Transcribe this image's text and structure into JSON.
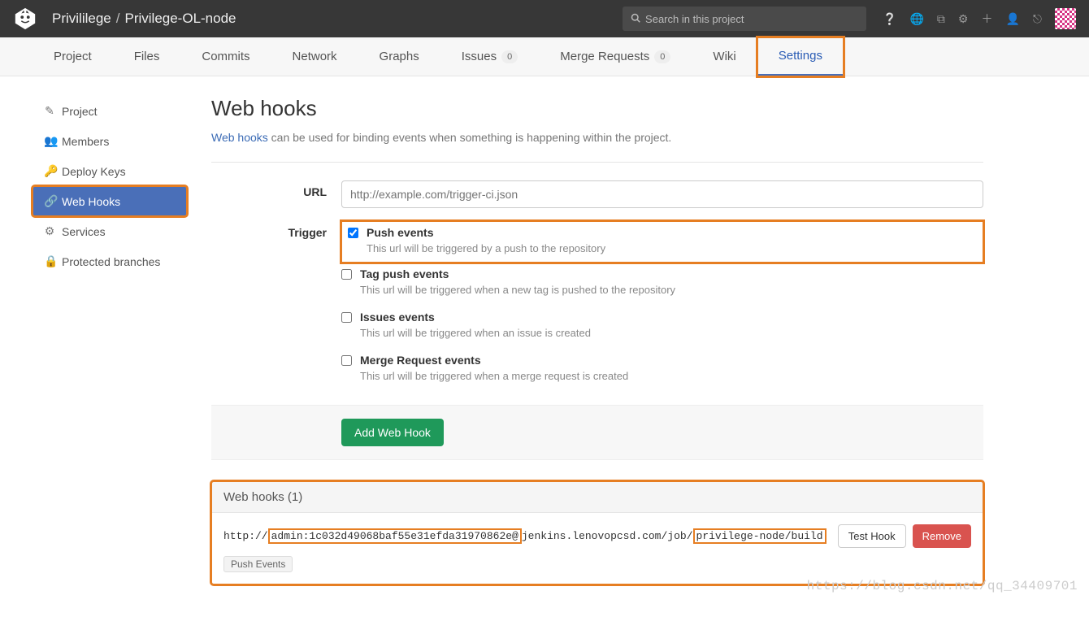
{
  "navbar": {
    "crumb_group": "Privililege",
    "crumb_project": "Privilege-OL-node",
    "search_placeholder": "Search in this project"
  },
  "tabs": [
    {
      "id": "project",
      "label": "Project"
    },
    {
      "id": "files",
      "label": "Files"
    },
    {
      "id": "commits",
      "label": "Commits"
    },
    {
      "id": "network",
      "label": "Network"
    },
    {
      "id": "graphs",
      "label": "Graphs"
    },
    {
      "id": "issues",
      "label": "Issues",
      "count": "0"
    },
    {
      "id": "merge",
      "label": "Merge Requests",
      "count": "0"
    },
    {
      "id": "wiki",
      "label": "Wiki"
    },
    {
      "id": "settings",
      "label": "Settings",
      "active": true
    }
  ],
  "sidebar": [
    {
      "id": "project",
      "label": "Project",
      "icon": "✎"
    },
    {
      "id": "members",
      "label": "Members",
      "icon": "👥"
    },
    {
      "id": "deploy",
      "label": "Deploy Keys",
      "icon": "🔑"
    },
    {
      "id": "webhooks",
      "label": "Web Hooks",
      "icon": "🔗",
      "active": true
    },
    {
      "id": "services",
      "label": "Services",
      "icon": "⚙"
    },
    {
      "id": "protected",
      "label": "Protected branches",
      "icon": "🔒"
    }
  ],
  "page": {
    "title": "Web hooks",
    "intro_link": "Web hooks",
    "intro_rest": " can be used for binding events when something is happening within the project."
  },
  "form": {
    "url_label": "URL",
    "url_placeholder": "http://example.com/trigger-ci.json",
    "trigger_label": "Trigger",
    "triggers": [
      {
        "id": "push",
        "title": "Push events",
        "desc": "This url will be triggered by a push to the repository",
        "checked": true,
        "highlight": true
      },
      {
        "id": "tag",
        "title": "Tag push events",
        "desc": "This url will be triggered when a new tag is pushed to the repository",
        "checked": false
      },
      {
        "id": "issues",
        "title": "Issues events",
        "desc": "This url will be triggered when an issue is created",
        "checked": false
      },
      {
        "id": "merge",
        "title": "Merge Request events",
        "desc": "This url will be triggered when a merge request is created",
        "checked": false
      }
    ],
    "submit_label": "Add Web Hook"
  },
  "hooks": {
    "panel_title": "Web hooks (1)",
    "url_prefix": "http://",
    "url_creds": "admin:1c032d49068baf55e31efda31970862e@",
    "url_host": "jenkins.lenovopcsd.com/job/",
    "url_path": "privilege-node/build",
    "test_label": "Test Hook",
    "remove_label": "Remove",
    "event_tag": "Push Events"
  },
  "watermark": "https://blog.csdn.net/qq_34409701"
}
